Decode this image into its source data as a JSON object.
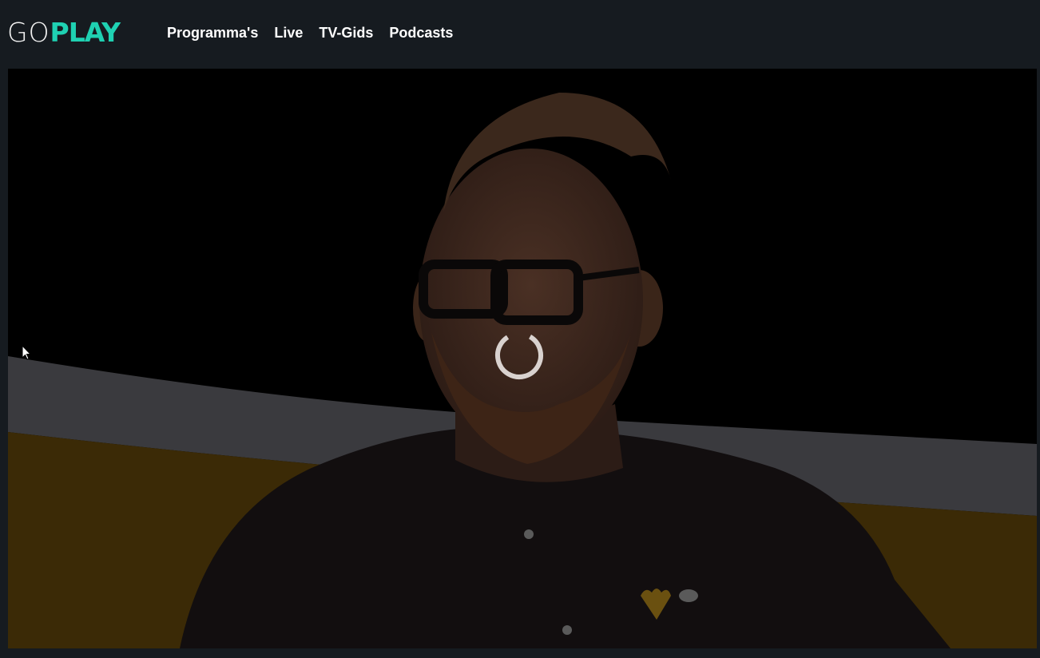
{
  "brand": {
    "logo_go": "GO",
    "logo_play": "PLAY",
    "accent_color": "#1fd1b2"
  },
  "nav": {
    "items": [
      {
        "label": "Programma's"
      },
      {
        "label": "Live"
      },
      {
        "label": "TV-Gids"
      },
      {
        "label": "Podcasts"
      }
    ]
  },
  "player": {
    "state": "loading",
    "spinner_icon": "loading-spinner-icon"
  }
}
